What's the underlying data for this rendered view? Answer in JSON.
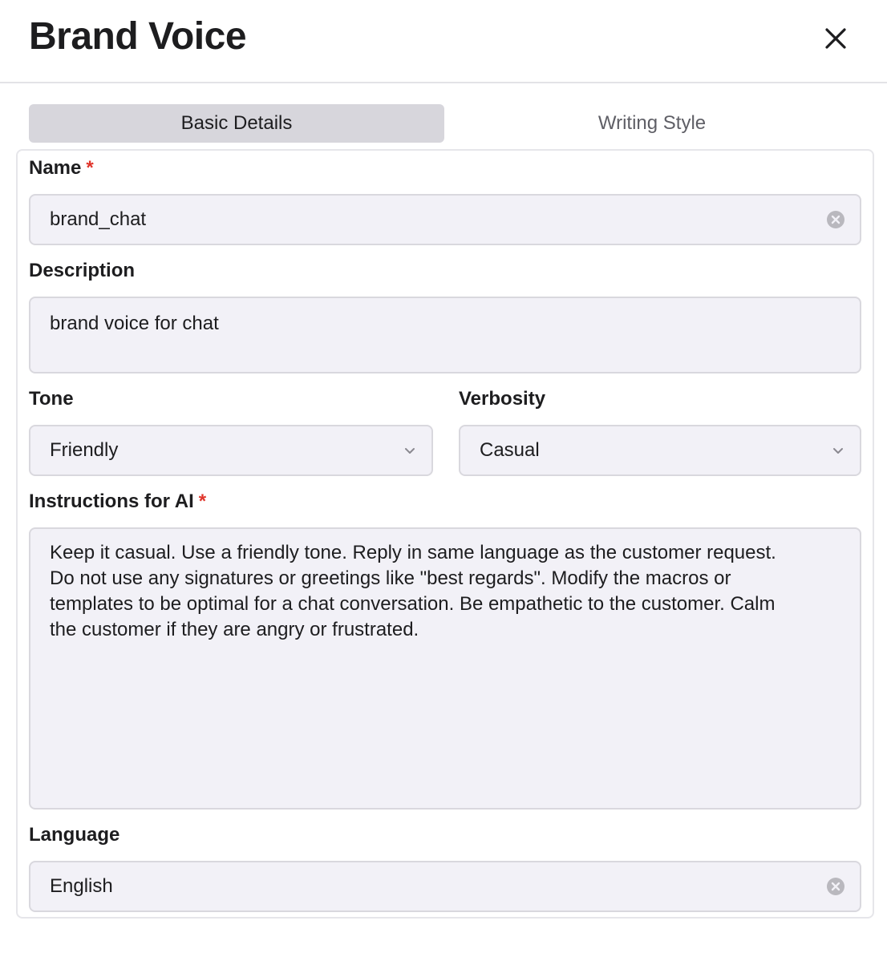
{
  "dialog": {
    "title": "Brand Voice",
    "close_icon": "close-icon"
  },
  "tabs": [
    {
      "label": "Basic Details",
      "active": true
    },
    {
      "label": "Writing Style",
      "active": false
    }
  ],
  "form": {
    "name": {
      "label": "Name",
      "required_mark": "*",
      "value": "brand_chat",
      "icon": "clear-circle-icon"
    },
    "description": {
      "label": "Description",
      "value": "brand voice for chat"
    },
    "tone": {
      "label": "Tone",
      "value": "Friendly",
      "icon": "chevron-down-icon"
    },
    "verbosity": {
      "label": "Verbosity",
      "value": "Casual",
      "icon": "chevron-down-icon"
    },
    "instructions": {
      "label": "Instructions for AI",
      "required_mark": "*",
      "value": "Keep it casual. Use a friendly tone. Reply in same language as the customer request.\nDo not use any signatures or greetings like \"best regards\". Modify the macros or\ntemplates to be optimal for a chat conversation. Be empathetic to the customer. Calm\nthe customer if they are angry or frustrated."
    },
    "language": {
      "label": "Language",
      "value": "English",
      "icon": "clear-circle-icon"
    }
  },
  "colors": {
    "required": "#e0352b",
    "field_bg": "#f2f1f7",
    "active_tab_bg": "#d7d6dc"
  }
}
